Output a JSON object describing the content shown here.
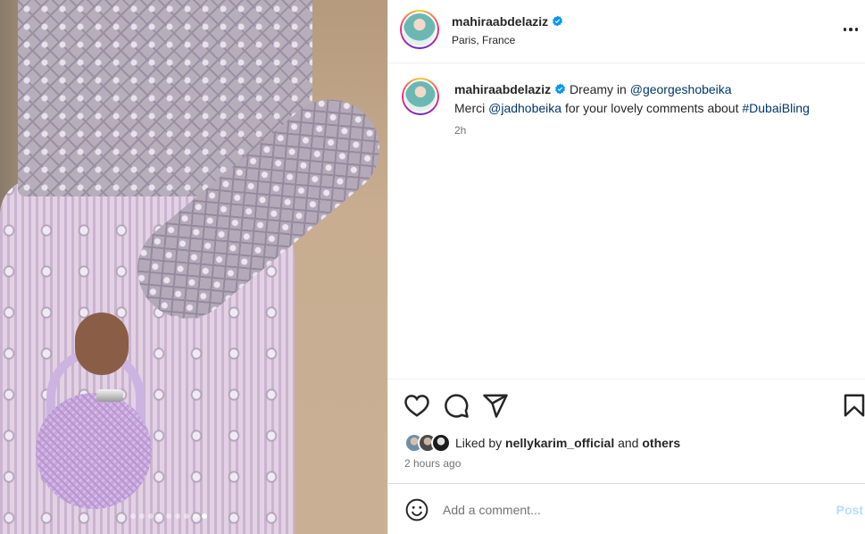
{
  "post": {
    "username": "mahiraabdelaziz",
    "location": "Paris, France"
  },
  "caption": {
    "username": "mahiraabdelaziz",
    "text_before_mention1": "Dreamy in",
    "mention1": "@georgeshobeika",
    "text_before_mention2": "Merci",
    "mention2": "@jadhobeika",
    "text_middle": "for your lovely comments about",
    "hashtag": "#DubaiBling",
    "time": "2h"
  },
  "likes": {
    "prefix": "Liked by",
    "user": "nellykarim_official",
    "joiner": "and",
    "others": "others",
    "posted_ago": "2 hours ago"
  },
  "comment": {
    "placeholder": "Add a comment...",
    "post_label": "Post"
  },
  "carousel": {
    "count": 9,
    "active_index": 8
  },
  "colors": {
    "verified": "#0095f6",
    "link": "#00376b",
    "post_disabled": "#b2dffc"
  },
  "icons": [
    "more-options-icon",
    "verified-badge-icon",
    "heart-icon",
    "comment-icon",
    "share-icon",
    "bookmark-icon",
    "emoji-icon"
  ]
}
